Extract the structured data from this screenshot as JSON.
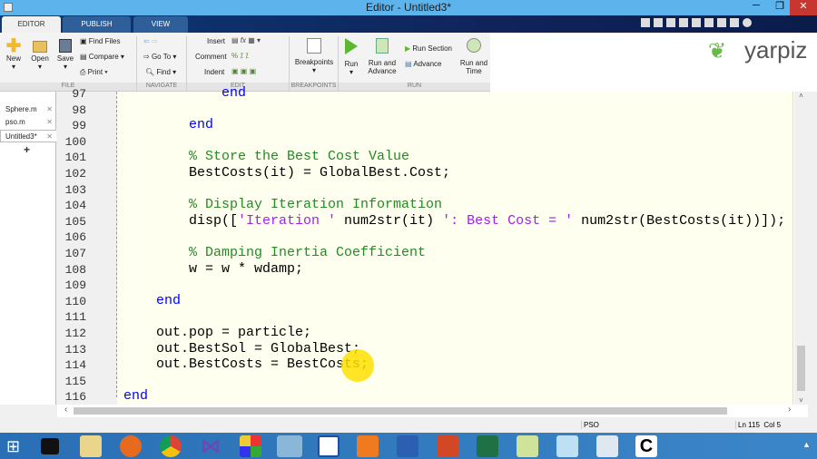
{
  "window": {
    "title": "Editor - Untitled3*"
  },
  "tabs": [
    {
      "label": "EDITOR"
    },
    {
      "label": "PUBLISH"
    },
    {
      "label": "VIEW"
    }
  ],
  "ribbon": {
    "file": {
      "new": "New",
      "open": "Open",
      "save": "Save",
      "find_files": "Find Files",
      "compare": "Compare",
      "print": "Print",
      "group": "FILE"
    },
    "navigate": {
      "goto": "Go To",
      "find": "Find",
      "group": "NAVIGATE"
    },
    "edit": {
      "insert": "Insert",
      "comment": "Comment",
      "indent": "Indent",
      "group": "EDIT"
    },
    "breakpoints": {
      "label": "Breakpoints",
      "group": "BREAKPOINTS"
    },
    "run": {
      "run": "Run",
      "run_advance": "Run and Advance",
      "run_section": "Run Section",
      "advance": "Advance",
      "run_time": "Run and Time",
      "group": "RUN"
    }
  },
  "logo": "yarpiz",
  "files": [
    {
      "name": "Sphere.m"
    },
    {
      "name": "pso.m"
    },
    {
      "name": "Untitled3*"
    }
  ],
  "add_tab": "+",
  "code_lines": [
    {
      "n": "97",
      "indent": 3,
      "parts": [
        [
          "kw",
          "end"
        ]
      ]
    },
    {
      "n": "98",
      "indent": 0,
      "parts": []
    },
    {
      "n": "99",
      "indent": 2,
      "parts": [
        [
          "kw",
          "end"
        ]
      ]
    },
    {
      "n": "100",
      "indent": 0,
      "parts": []
    },
    {
      "n": "101",
      "indent": 2,
      "parts": [
        [
          "cm",
          "% Store the Best Cost Value"
        ]
      ]
    },
    {
      "n": "102",
      "indent": 2,
      "parts": [
        [
          "",
          "BestCosts(it) = GlobalBest.Cost;"
        ]
      ]
    },
    {
      "n": "103",
      "indent": 0,
      "parts": []
    },
    {
      "n": "104",
      "indent": 2,
      "parts": [
        [
          "cm",
          "% Display Iteration Information"
        ]
      ]
    },
    {
      "n": "105",
      "indent": 2,
      "parts": [
        [
          "",
          "disp(["
        ],
        [
          "st",
          "'Iteration '"
        ],
        [
          "",
          " num2str(it) "
        ],
        [
          "st",
          "': Best Cost = '"
        ],
        [
          "",
          " num2str(BestCosts(it))]);"
        ]
      ]
    },
    {
      "n": "106",
      "indent": 0,
      "parts": []
    },
    {
      "n": "107",
      "indent": 2,
      "parts": [
        [
          "cm",
          "% Damping Inertia Coefficient"
        ]
      ]
    },
    {
      "n": "108",
      "indent": 2,
      "parts": [
        [
          "",
          "w = w * wdamp;"
        ]
      ]
    },
    {
      "n": "109",
      "indent": 0,
      "parts": []
    },
    {
      "n": "110",
      "indent": 1,
      "parts": [
        [
          "kw",
          "end"
        ]
      ]
    },
    {
      "n": "111",
      "indent": 0,
      "parts": []
    },
    {
      "n": "112",
      "indent": 1,
      "parts": [
        [
          "",
          "out.pop = particle;"
        ]
      ]
    },
    {
      "n": "113",
      "indent": 1,
      "parts": [
        [
          "",
          "out.BestSol = GlobalBest;"
        ]
      ]
    },
    {
      "n": "114",
      "indent": 1,
      "parts": [
        [
          "",
          "out.BestCosts = BestCosts;"
        ]
      ]
    },
    {
      "n": "115",
      "indent": 0,
      "parts": []
    },
    {
      "n": "116",
      "indent": 0,
      "parts": [
        [
          "kw",
          "end"
        ]
      ]
    }
  ],
  "status": {
    "context": "PSO",
    "ln_label": "Ln",
    "ln": "115",
    "col_label": "Col",
    "col": "5"
  }
}
